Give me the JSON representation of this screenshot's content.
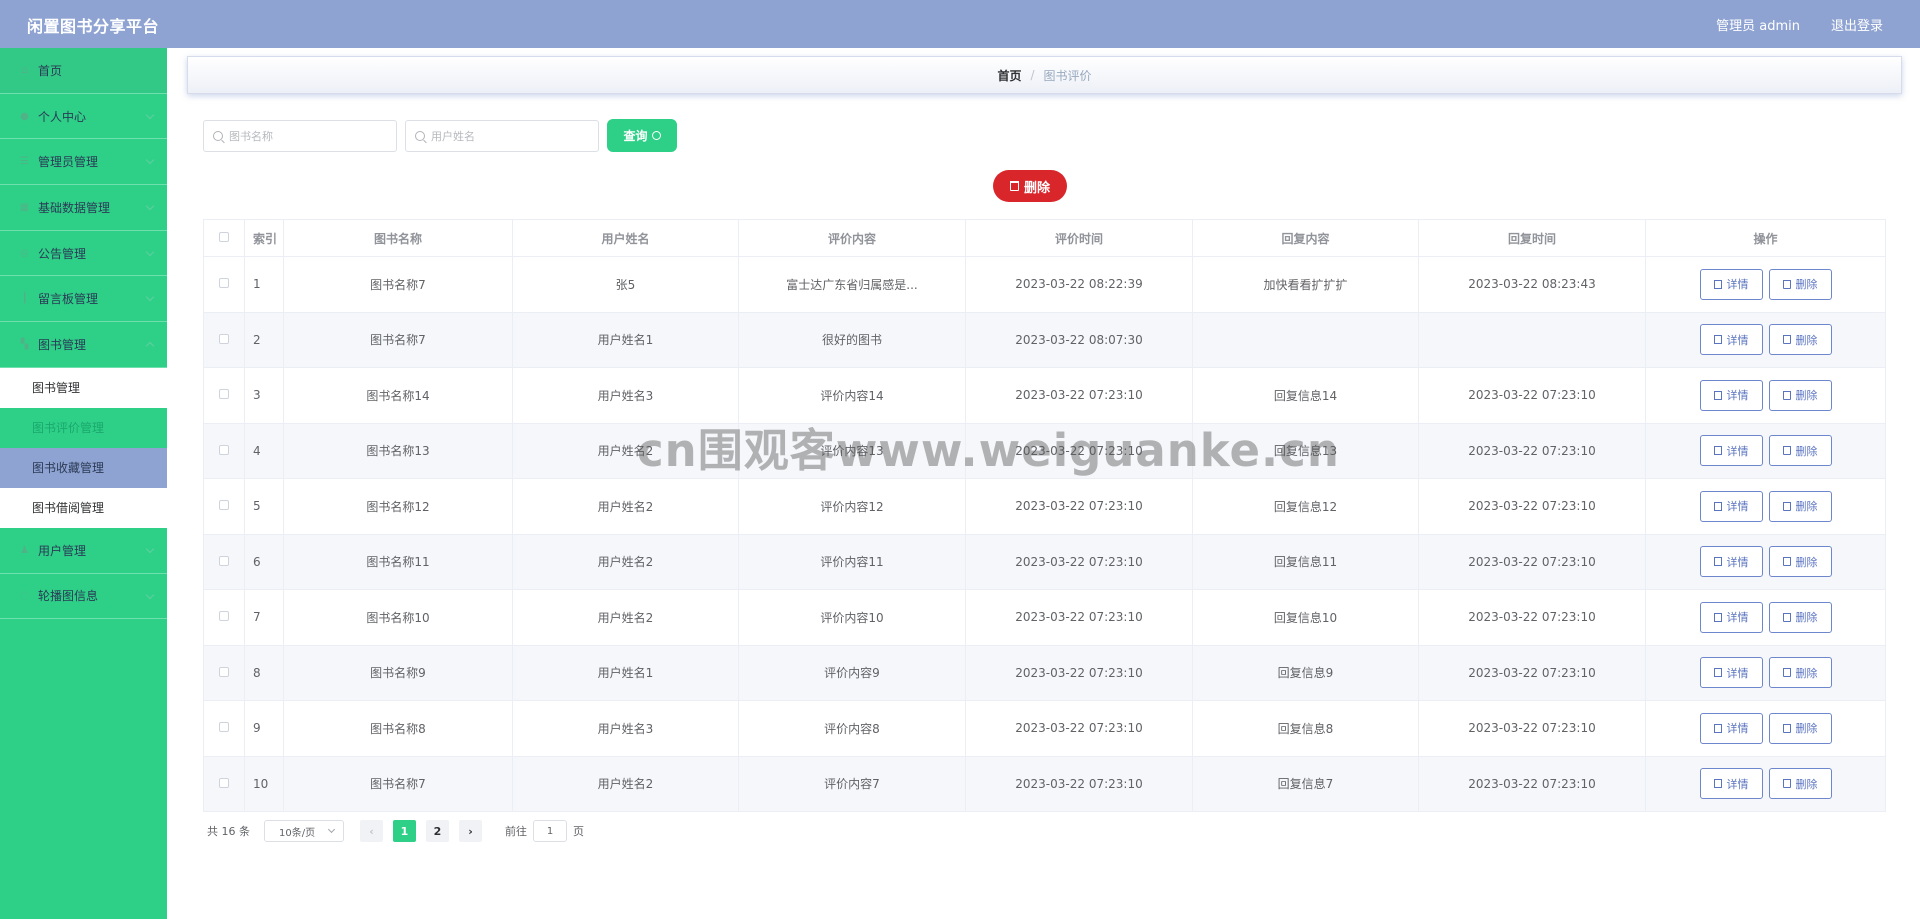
{
  "header": {
    "title": "闲置图书分享平台",
    "user": "管理员 admin",
    "logout": "退出登录"
  },
  "sidebar": {
    "items": [
      {
        "label": "首页",
        "icon": "home-icon"
      },
      {
        "label": "个人中心",
        "icon": "user-icon"
      },
      {
        "label": "管理员管理",
        "icon": "admin-icon"
      },
      {
        "label": "基础数据管理",
        "icon": "data-icon"
      },
      {
        "label": "公告管理",
        "icon": "notice-icon"
      },
      {
        "label": "留言板管理",
        "icon": "message-icon"
      },
      {
        "label": "图书管理",
        "icon": "book-icon"
      }
    ],
    "submenu": [
      "图书管理",
      "图书评价管理",
      "图书收藏管理",
      "图书借阅管理"
    ],
    "items_after": [
      {
        "label": "用户管理",
        "icon": "users-icon"
      },
      {
        "label": "轮播图信息",
        "icon": "carousel-icon"
      }
    ]
  },
  "breadcrumb": {
    "home": "首页",
    "separator": "/",
    "current": "图书评价"
  },
  "search": {
    "book_placeholder": "图书名称",
    "user_placeholder": "用户姓名",
    "query_label": "查询"
  },
  "batch_delete_label": "删除",
  "table": {
    "headers": [
      "索引",
      "图书名称",
      "用户姓名",
      "评价内容",
      "评价时间",
      "回复内容",
      "回复时间",
      "操作"
    ],
    "detail_label": "详情",
    "delete_label": "删除",
    "rows": [
      {
        "index": "1",
        "book": "图书名称7",
        "user": "张5",
        "content": "富士达广东省归属感是...",
        "time": "2023-03-22 08:22:39",
        "reply": "加快看看扩扩扩",
        "reply_time": "2023-03-22 08:23:43"
      },
      {
        "index": "2",
        "book": "图书名称7",
        "user": "用户姓名1",
        "content": "很好的图书",
        "time": "2023-03-22 08:07:30",
        "reply": "",
        "reply_time": ""
      },
      {
        "index": "3",
        "book": "图书名称14",
        "user": "用户姓名3",
        "content": "评价内容14",
        "time": "2023-03-22 07:23:10",
        "reply": "回复信息14",
        "reply_time": "2023-03-22 07:23:10"
      },
      {
        "index": "4",
        "book": "图书名称13",
        "user": "用户姓名2",
        "content": "评价内容13",
        "time": "2023-03-22 07:23:10",
        "reply": "回复信息13",
        "reply_time": "2023-03-22 07:23:10"
      },
      {
        "index": "5",
        "book": "图书名称12",
        "user": "用户姓名2",
        "content": "评价内容12",
        "time": "2023-03-22 07:23:10",
        "reply": "回复信息12",
        "reply_time": "2023-03-22 07:23:10"
      },
      {
        "index": "6",
        "book": "图书名称11",
        "user": "用户姓名2",
        "content": "评价内容11",
        "time": "2023-03-22 07:23:10",
        "reply": "回复信息11",
        "reply_time": "2023-03-22 07:23:10"
      },
      {
        "index": "7",
        "book": "图书名称10",
        "user": "用户姓名2",
        "content": "评价内容10",
        "time": "2023-03-22 07:23:10",
        "reply": "回复信息10",
        "reply_time": "2023-03-22 07:23:10"
      },
      {
        "index": "8",
        "book": "图书名称9",
        "user": "用户姓名1",
        "content": "评价内容9",
        "time": "2023-03-22 07:23:10",
        "reply": "回复信息9",
        "reply_time": "2023-03-22 07:23:10"
      },
      {
        "index": "9",
        "book": "图书名称8",
        "user": "用户姓名3",
        "content": "评价内容8",
        "time": "2023-03-22 07:23:10",
        "reply": "回复信息8",
        "reply_time": "2023-03-22 07:23:10"
      },
      {
        "index": "10",
        "book": "图书名称7",
        "user": "用户姓名2",
        "content": "评价内容7",
        "time": "2023-03-22 07:23:10",
        "reply": "回复信息7",
        "reply_time": "2023-03-22 07:23:10"
      }
    ]
  },
  "pagination": {
    "total": "共 16 条",
    "page_size": "10条/页",
    "pages": [
      "1",
      "2"
    ],
    "current_page": "1",
    "goto_prefix": "前往",
    "goto_value": "1",
    "goto_suffix": "页"
  },
  "watermark": "cn围观客www.weiguanke.cn",
  "colors": {
    "header": "#8fa3d2",
    "sidebar": "#2ed088",
    "danger": "#d9262b",
    "primary_outline": "#6e87cc"
  }
}
